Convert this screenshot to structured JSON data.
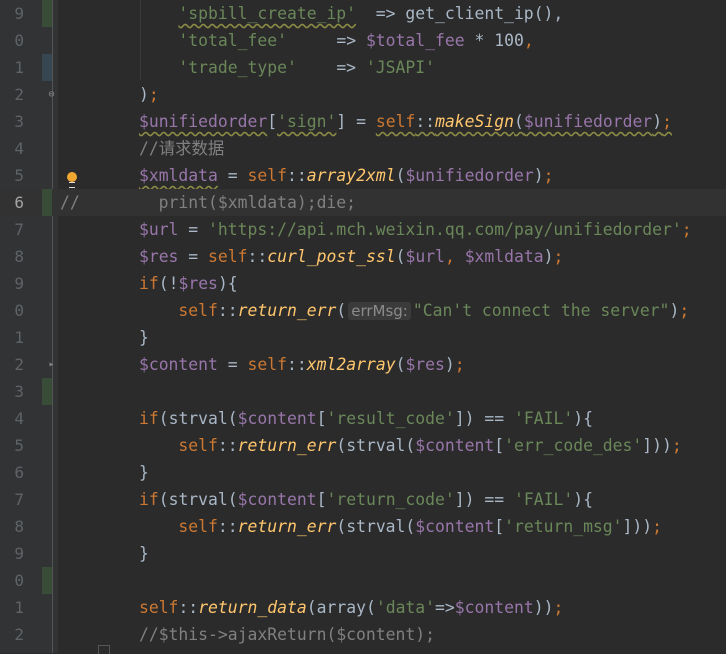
{
  "editor": {
    "colors": {
      "background": "#2b2b2b",
      "string": "#6a8759",
      "variable": "#9876aa",
      "keyword": "#cc7832",
      "function": "#ffc66d",
      "comment": "#808080"
    },
    "lines": [
      {
        "n": "9",
        "chg": "add",
        "t": [
          [
            "            ",
            "p"
          ],
          [
            "'spbill_create_ip'",
            "s",
            1
          ],
          [
            "  => ",
            "p"
          ],
          [
            "get_client_ip",
            "p"
          ],
          [
            "(),",
            "p"
          ]
        ]
      },
      {
        "n": "0",
        "t": [
          [
            "            ",
            "p"
          ],
          [
            "'total_fee'",
            "s"
          ],
          [
            "     => ",
            "p"
          ],
          [
            "$total_fee",
            "v"
          ],
          [
            " * ",
            "p"
          ],
          [
            "100",
            "p"
          ],
          [
            ",",
            "k"
          ]
        ]
      },
      {
        "n": "1",
        "chg": "mod",
        "t": [
          [
            "            ",
            "p"
          ],
          [
            "'trade_type'",
            "s"
          ],
          [
            "    => ",
            "p"
          ],
          [
            "'JSAPI'",
            "s"
          ]
        ]
      },
      {
        "n": "2",
        "fold": "⊖",
        "t": [
          [
            "        ",
            "p"
          ],
          [
            ")",
            "p"
          ],
          [
            ";",
            "k"
          ]
        ]
      },
      {
        "n": "3",
        "t": [
          [
            "        ",
            "p"
          ],
          [
            "$unifiedorder",
            "v",
            1
          ],
          [
            "[",
            "p"
          ],
          [
            "'sign'",
            "s",
            1
          ],
          [
            "] = ",
            "p"
          ],
          [
            "self",
            "k",
            1
          ],
          [
            "::",
            "p",
            1
          ],
          [
            "makeSign",
            "f",
            1
          ],
          [
            "(",
            "p",
            1
          ],
          [
            "$unifiedorder",
            "v",
            1
          ],
          [
            ")",
            "p",
            1
          ],
          [
            ";",
            "k",
            1
          ]
        ]
      },
      {
        "n": "4",
        "t": [
          [
            "        ",
            "p"
          ],
          [
            "//请求数据",
            "c"
          ]
        ]
      },
      {
        "n": "5",
        "t": [
          [
            "        ",
            "p"
          ],
          [
            "$xmldata",
            "v",
            1
          ],
          [
            " = ",
            "p"
          ],
          [
            "self",
            "k"
          ],
          [
            "::",
            "p"
          ],
          [
            "array2xml",
            "f"
          ],
          [
            "(",
            "p"
          ],
          [
            "$unifiedorder",
            "v"
          ],
          [
            ")",
            "p"
          ],
          [
            ";",
            "k"
          ]
        ]
      },
      {
        "n": "6",
        "chg": "add",
        "current": true,
        "t": [
          [
            "//        print($xmldata);die;",
            "c"
          ]
        ]
      },
      {
        "n": "7",
        "t": [
          [
            "        ",
            "p"
          ],
          [
            "$url",
            "v"
          ],
          [
            " = ",
            "p"
          ],
          [
            "'https://api.mch.weixin.qq.com/pay/unifiedorder'",
            "s"
          ],
          [
            ";",
            "k"
          ]
        ]
      },
      {
        "n": "8",
        "t": [
          [
            "        ",
            "p"
          ],
          [
            "$res",
            "v"
          ],
          [
            " = ",
            "p"
          ],
          [
            "self",
            "k"
          ],
          [
            "::",
            "p"
          ],
          [
            "curl_post_ssl",
            "f"
          ],
          [
            "(",
            "p"
          ],
          [
            "$url",
            "v"
          ],
          [
            ", ",
            "k"
          ],
          [
            "$xmldata",
            "v"
          ],
          [
            ")",
            "p"
          ],
          [
            ";",
            "k"
          ]
        ]
      },
      {
        "n": "9",
        "t": [
          [
            "        ",
            "p"
          ],
          [
            "if",
            "k"
          ],
          [
            "(!",
            "p"
          ],
          [
            "$res",
            "v"
          ],
          [
            "){",
            "p"
          ]
        ]
      },
      {
        "n": "0",
        "t": [
          [
            "            ",
            "p"
          ],
          [
            "self",
            "k"
          ],
          [
            "::",
            "p"
          ],
          [
            "return_err",
            "f"
          ],
          [
            "(",
            "p"
          ],
          [
            "errMsg:",
            "h"
          ],
          [
            "\"Can't connect the server\"",
            "s"
          ],
          [
            ")",
            "p"
          ],
          [
            ";",
            "k"
          ]
        ]
      },
      {
        "n": "1",
        "t": [
          [
            "        ",
            "p"
          ],
          [
            "}",
            "p"
          ]
        ]
      },
      {
        "n": "2",
        "fold": "▸",
        "t": [
          [
            "        ",
            "p"
          ],
          [
            "$content",
            "v"
          ],
          [
            " = ",
            "p"
          ],
          [
            "self",
            "k"
          ],
          [
            "::",
            "p"
          ],
          [
            "xml2array",
            "f"
          ],
          [
            "(",
            "p"
          ],
          [
            "$res",
            "v"
          ],
          [
            ")",
            "p"
          ],
          [
            ";",
            "k"
          ]
        ]
      },
      {
        "n": "3",
        "chg": "add",
        "t": []
      },
      {
        "n": "4",
        "t": [
          [
            "        ",
            "p"
          ],
          [
            "if",
            "k"
          ],
          [
            "(strval(",
            "p"
          ],
          [
            "$content",
            "v"
          ],
          [
            "[",
            "p"
          ],
          [
            "'result_code'",
            "s"
          ],
          [
            "]) == ",
            "p"
          ],
          [
            "'FAIL'",
            "s"
          ],
          [
            "){",
            "p"
          ]
        ]
      },
      {
        "n": "5",
        "t": [
          [
            "            ",
            "p"
          ],
          [
            "self",
            "k"
          ],
          [
            "::",
            "p"
          ],
          [
            "return_err",
            "f"
          ],
          [
            "(strval(",
            "p"
          ],
          [
            "$content",
            "v"
          ],
          [
            "[",
            "p"
          ],
          [
            "'err_code_des'",
            "s"
          ],
          [
            "]))",
            "p"
          ],
          [
            ";",
            "k"
          ]
        ]
      },
      {
        "n": "6",
        "t": [
          [
            "        ",
            "p"
          ],
          [
            "}",
            "p"
          ]
        ]
      },
      {
        "n": "7",
        "t": [
          [
            "        ",
            "p"
          ],
          [
            "if",
            "k"
          ],
          [
            "(strval(",
            "p"
          ],
          [
            "$content",
            "v"
          ],
          [
            "[",
            "p"
          ],
          [
            "'return_code'",
            "s"
          ],
          [
            "]) == ",
            "p"
          ],
          [
            "'FAIL'",
            "s"
          ],
          [
            "){",
            "p"
          ]
        ]
      },
      {
        "n": "8",
        "t": [
          [
            "            ",
            "p"
          ],
          [
            "self",
            "k"
          ],
          [
            "::",
            "p"
          ],
          [
            "return_err",
            "f"
          ],
          [
            "(strval(",
            "p"
          ],
          [
            "$content",
            "v"
          ],
          [
            "[",
            "p"
          ],
          [
            "'return_msg'",
            "s"
          ],
          [
            "]))",
            "p"
          ],
          [
            ";",
            "k"
          ]
        ]
      },
      {
        "n": "9",
        "t": [
          [
            "        ",
            "p"
          ],
          [
            "}",
            "p"
          ]
        ]
      },
      {
        "n": "0",
        "chg": "add",
        "t": []
      },
      {
        "n": "1",
        "t": [
          [
            "        ",
            "p"
          ],
          [
            "self",
            "k"
          ],
          [
            "::",
            "p"
          ],
          [
            "return_data",
            "f"
          ],
          [
            "(array(",
            "p"
          ],
          [
            "'data'",
            "s"
          ],
          [
            "=>",
            "p"
          ],
          [
            "$content",
            "v"
          ],
          [
            "))",
            "p"
          ],
          [
            ";",
            "k"
          ]
        ]
      },
      {
        "n": "2",
        "t": [
          [
            "        ",
            "p"
          ],
          [
            "//$this->ajaxReturn($content);",
            "c"
          ]
        ]
      }
    ]
  }
}
